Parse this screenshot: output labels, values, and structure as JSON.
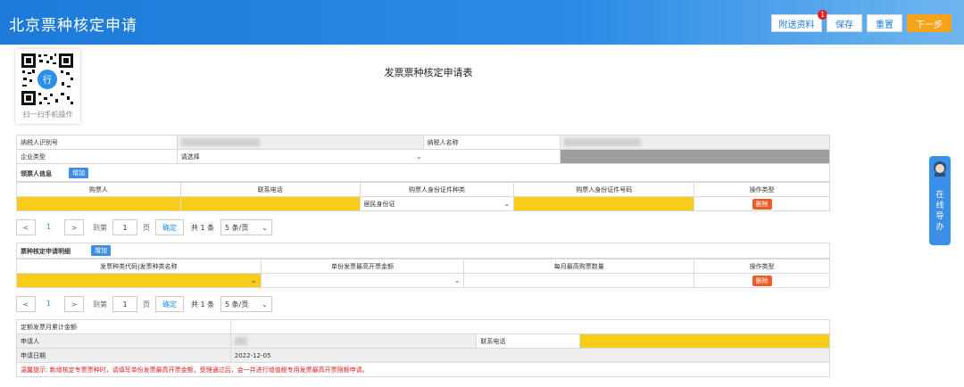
{
  "header": {
    "title": "北京票种核定申请",
    "buttons": {
      "attach": "附送资料",
      "attach_badge": "1",
      "save": "保存",
      "reset": "重置",
      "next": "下一步"
    }
  },
  "qr": {
    "caption": "扫一扫手机操作",
    "logo": "行"
  },
  "form_title": "发票票种核定申请表",
  "basic": {
    "taxpayer_id_label": "纳税人识别号",
    "taxpayer_name_label": "纳税人名称",
    "enterprise_type_label": "企业类型",
    "enterprise_type_value": "请选择"
  },
  "buyer": {
    "section_label": "领票人信息",
    "add_label": "增加",
    "columns": [
      "购票人",
      "联系电话",
      "购票人身份证件种类",
      "购票人身份证件号码",
      "操作类型"
    ],
    "id_type_value": "居民身份证",
    "delete_label": "删除"
  },
  "pager1": {
    "prev": "<",
    "page": "1",
    "next": ">",
    "goto_label": "到第",
    "goto_value": "1",
    "page_label": "页",
    "confirm": "确定",
    "total": "共 1 条",
    "page_size": "5 条/页"
  },
  "detail": {
    "section_label": "票种核定申请明细",
    "add_label": "增加",
    "columns": [
      "发票种类代码|发票种类名称",
      "单份发票最高开票金额",
      "每月最高购票数量",
      "操作类型"
    ],
    "delete_label": "删除"
  },
  "pager2": {
    "prev": "<",
    "page": "1",
    "next": ">",
    "goto_label": "到第",
    "goto_value": "1",
    "page_label": "页",
    "confirm": "确定",
    "total": "共 1 条",
    "page_size": "5 条/页"
  },
  "bottom": {
    "monthly_total_label": "定额发票月累计金额",
    "applicant_label": "申请人",
    "contact_label": "联系电话",
    "apply_date_label": "申请日期",
    "apply_date_value": "2022-12-05",
    "notice": "温馨提示: 新增核定专票票种时，请填写单份发票最高开票金额，受理通过后，会一并进行增值税专用发票最高开票限额申请。"
  },
  "float_tab": {
    "text_lines": [
      "在",
      "线",
      "导",
      "办"
    ]
  },
  "colors": {
    "header_blue": "#1d7ad8",
    "accent_orange": "#f7a21b",
    "required_yellow": "#f7cc1a",
    "delete_red": "#ef5b25"
  }
}
